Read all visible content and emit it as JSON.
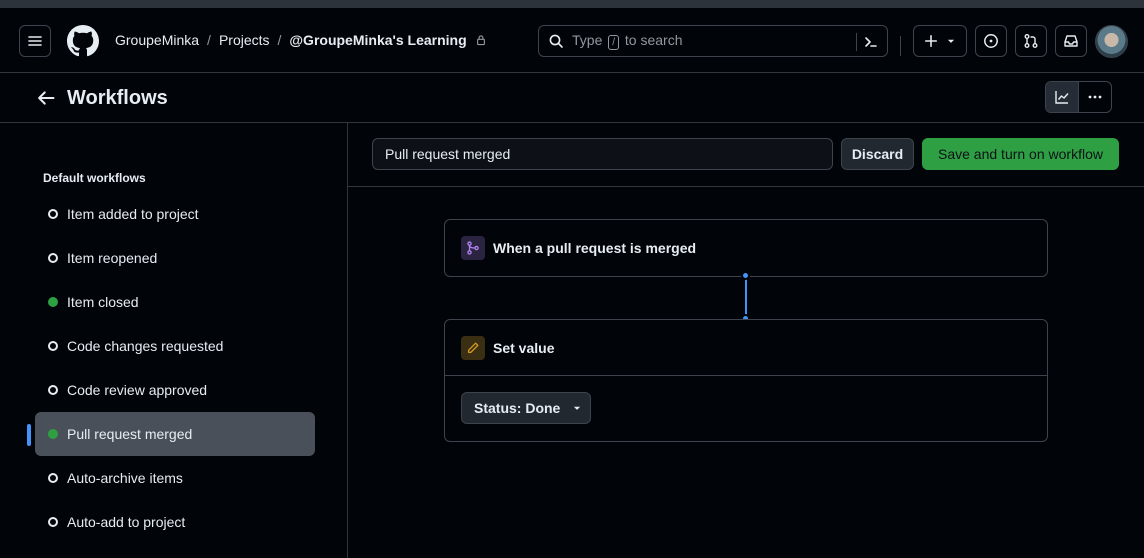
{
  "header": {
    "breadcrumbs": [
      "GroupeMinka",
      "Projects",
      "@GroupeMinka's Learning"
    ],
    "separator": "/",
    "search": {
      "prefix": "Type",
      "key": "/",
      "suffix": "to search"
    }
  },
  "page": {
    "title": "Workflows"
  },
  "sidebar": {
    "heading": "Default workflows",
    "items": [
      {
        "label": "Item added to project",
        "enabled": false
      },
      {
        "label": "Item reopened",
        "enabled": false
      },
      {
        "label": "Item closed",
        "enabled": true
      },
      {
        "label": "Code changes requested",
        "enabled": false
      },
      {
        "label": "Code review approved",
        "enabled": false
      },
      {
        "label": "Pull request merged",
        "enabled": true,
        "active": true
      },
      {
        "label": "Auto-archive items",
        "enabled": false
      },
      {
        "label": "Auto-add to project",
        "enabled": false
      }
    ]
  },
  "editor": {
    "workflow_name": "Pull request merged",
    "discard_label": "Discard",
    "save_label": "Save and turn on workflow",
    "trigger": {
      "title": "When a pull request is merged",
      "icon": "git-merge-icon"
    },
    "action": {
      "title": "Set value",
      "icon": "pencil-icon",
      "value_label": "Status: Done"
    }
  },
  "colors": {
    "accent": "#4493f8",
    "success": "#2ea043",
    "background": "#010409"
  }
}
